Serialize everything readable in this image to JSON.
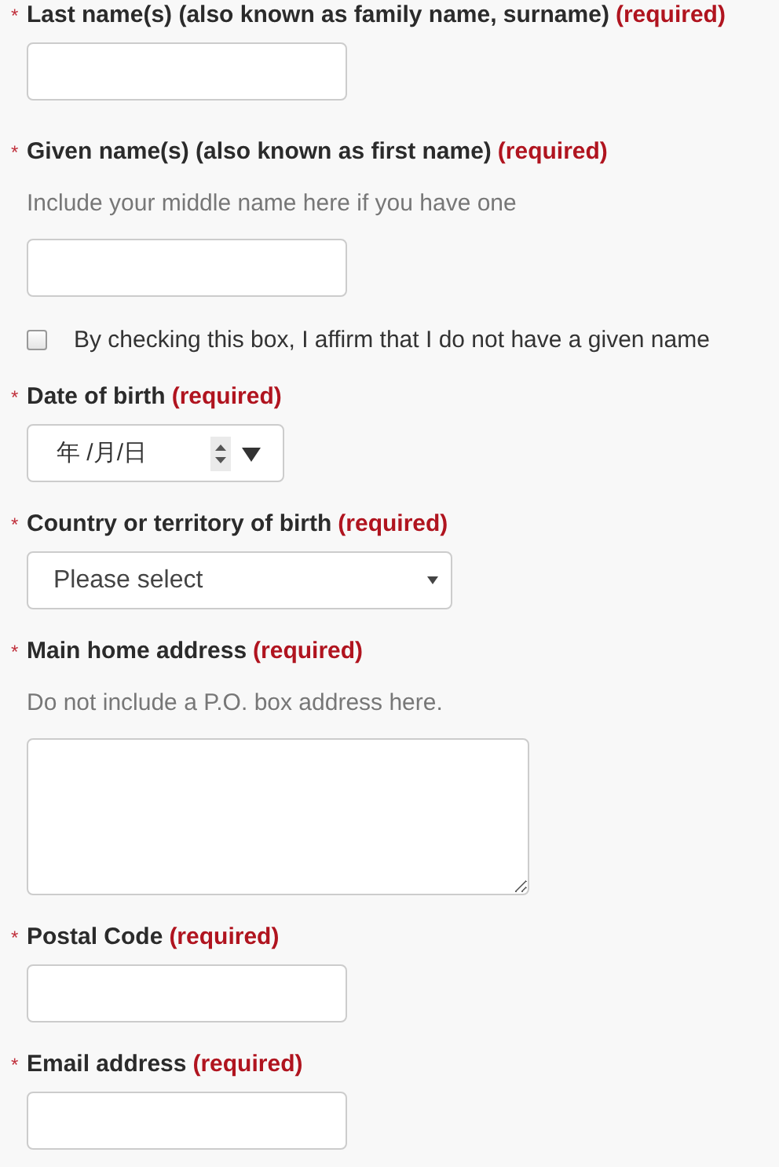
{
  "fields": [
    {
      "kind": "text",
      "marker": "*",
      "label": "Last name(s) (also known as family name, surname)",
      "required": "(required)"
    },
    {
      "kind": "text",
      "marker": "*",
      "label": "Given name(s) (also known as first name)",
      "required": "(required)",
      "hint": "Include your middle name here if you have one",
      "checkbox": {
        "label": "By checking this box, I affirm that I do not have a given name",
        "checked": false
      }
    },
    {
      "kind": "date",
      "marker": "*",
      "label": "Date of birth",
      "required": "(required)",
      "value": "年 /月/日"
    },
    {
      "kind": "select",
      "marker": "*",
      "label": "Country or territory of birth",
      "required": "(required)",
      "value": "Please select"
    },
    {
      "kind": "textarea",
      "marker": "*",
      "label": "Main home address",
      "required": "(required)",
      "hint": "Do not include a P.O. box address here."
    },
    {
      "kind": "text",
      "marker": "*",
      "label": "Postal Code",
      "required": "(required)"
    },
    {
      "kind": "text",
      "marker": "*",
      "label": "Email address",
      "required": "(required)"
    }
  ]
}
